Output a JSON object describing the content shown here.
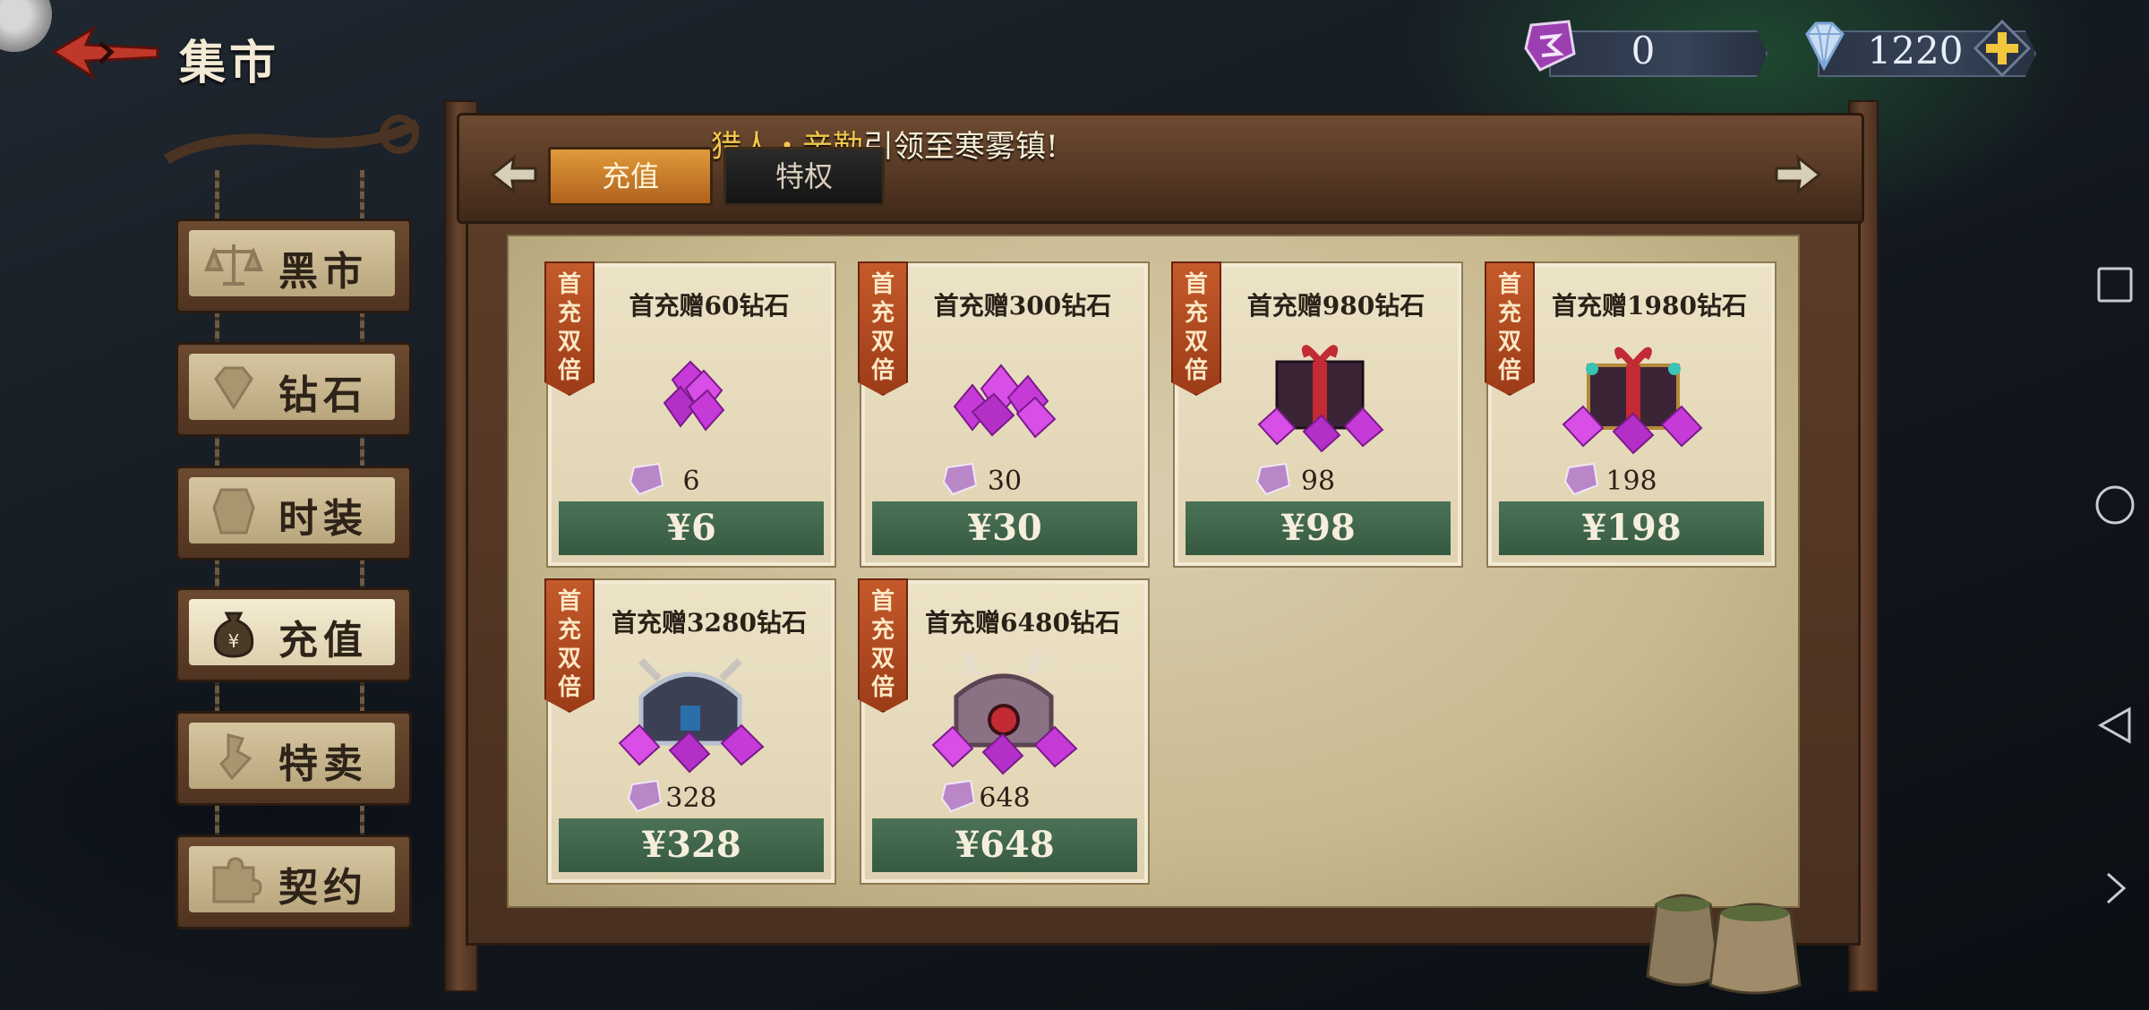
{
  "header": {
    "title": "集市",
    "currency_a": "0",
    "currency_b": "1220"
  },
  "tabs": {
    "active": "充值",
    "other": "特权"
  },
  "banner": {
    "highlight": "猎人・辛勒",
    "rest": "引领至寒雾镇!"
  },
  "sidebar": [
    {
      "label": "黑市",
      "icon": "scales-icon"
    },
    {
      "label": "钻石",
      "icon": "gem-icon"
    },
    {
      "label": "时装",
      "icon": "costume-icon"
    },
    {
      "label": "充值",
      "icon": "money-bag-icon",
      "active": true
    },
    {
      "label": "特卖",
      "icon": "sale-icon"
    },
    {
      "label": "契约",
      "icon": "puzzle-icon"
    }
  ],
  "products": [
    {
      "tag": "首充双倍",
      "title": "首充赠60钻石",
      "amount": "6",
      "price": "¥6"
    },
    {
      "tag": "首充双倍",
      "title": "首充赠300钻石",
      "amount": "30",
      "price": "¥30"
    },
    {
      "tag": "首充双倍",
      "title": "首充赠980钻石",
      "amount": "98",
      "price": "¥98"
    },
    {
      "tag": "首充双倍",
      "title": "首充赠1980钻石",
      "amount": "198",
      "price": "¥198"
    },
    {
      "tag": "首充双倍",
      "title": "首充赠3280钻石",
      "amount": "328",
      "price": "¥328"
    },
    {
      "tag": "首充双倍",
      "title": "首充赠6480钻石",
      "amount": "648",
      "price": "¥648"
    }
  ],
  "colors": {
    "accent_orange": "#c45a2a",
    "price_green": "#3f6449",
    "gem_purple": "#c63ad8"
  }
}
